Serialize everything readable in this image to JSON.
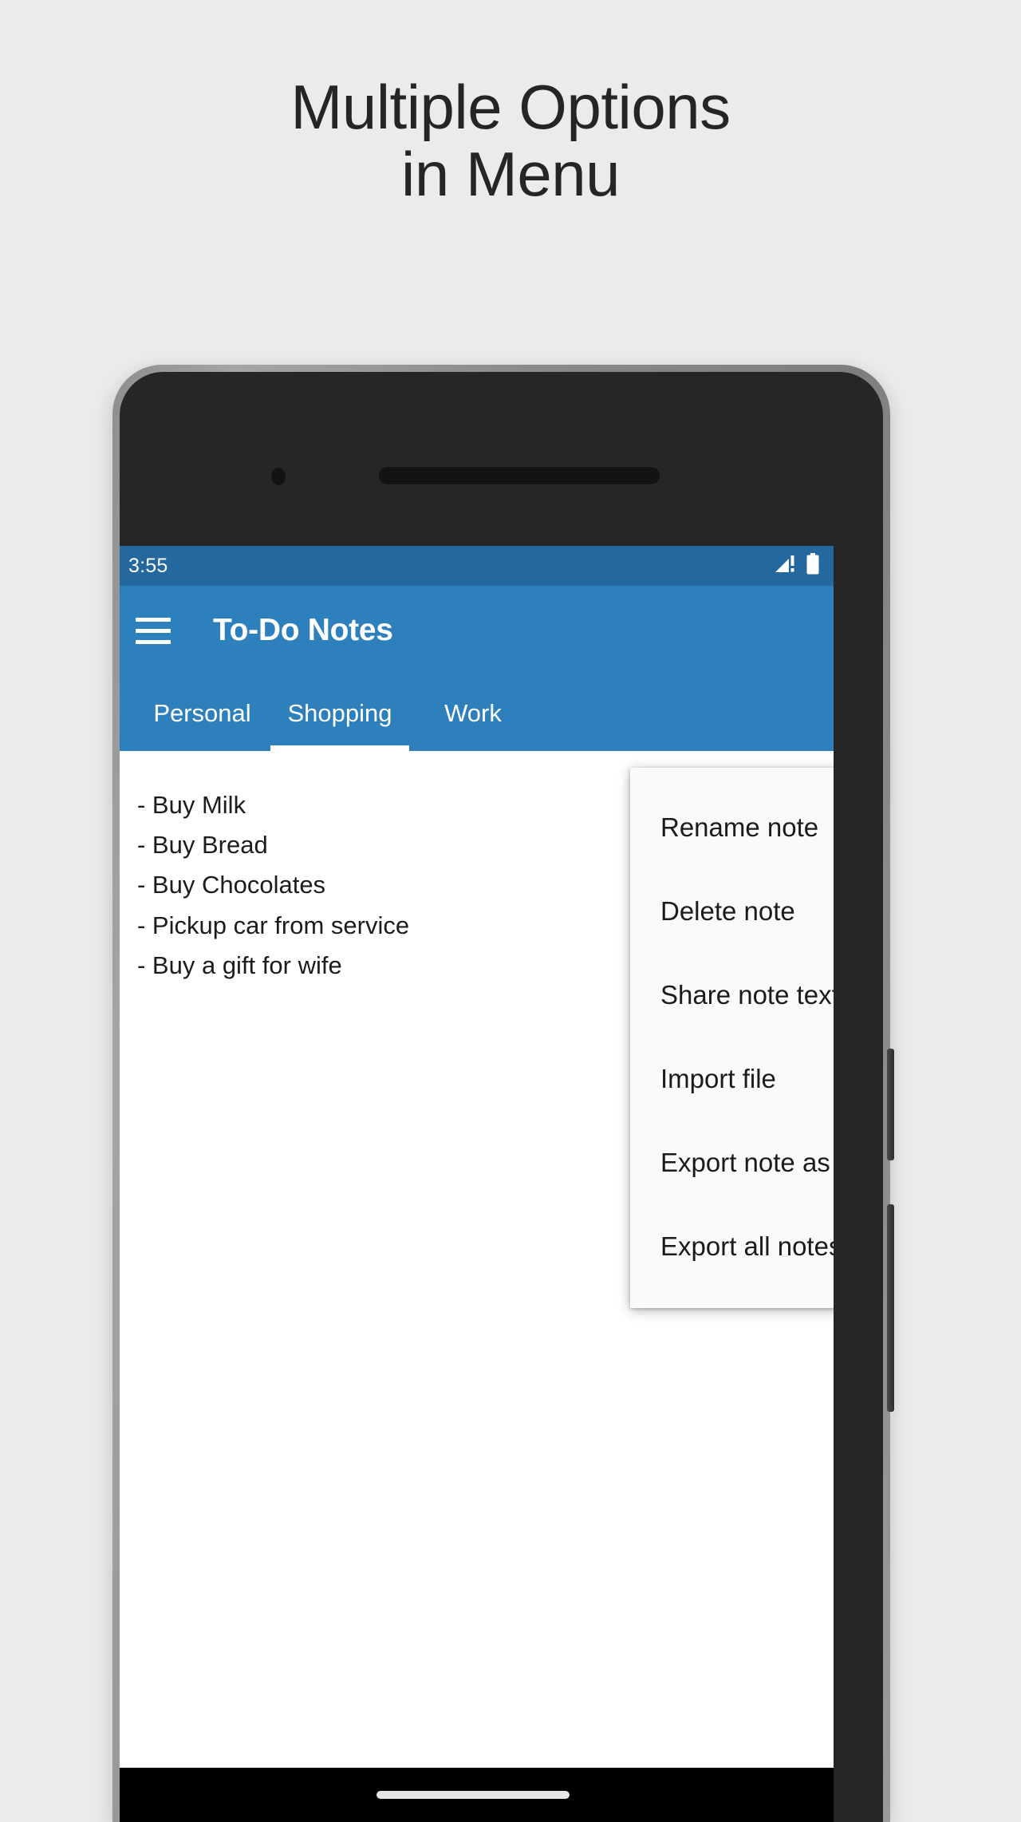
{
  "headline": {
    "line1": "Multiple Options",
    "line2": "in Menu"
  },
  "colors": {
    "page_background": "#ebebeb",
    "status_bar": "#24689e",
    "app_bar": "#2d80bb",
    "menu_background": "#fafafa",
    "text_primary": "#1b1b1b",
    "on_primary": "#ffffff"
  },
  "phone": {
    "status_bar": {
      "time": "3:55",
      "icons": [
        "signal-icon",
        "battery-icon"
      ]
    },
    "app_bar": {
      "menu_icon": "hamburger-icon",
      "title": "To-Do Notes"
    },
    "tabs": [
      {
        "label": "Personal",
        "active": false
      },
      {
        "label": "Shopping",
        "active": true
      },
      {
        "label": "Work",
        "active": false
      }
    ],
    "note": {
      "lines": [
        "- Buy Milk",
        "- Buy Bread",
        "- Buy Chocolates",
        "- Pickup car from service",
        "- Buy a gift for wife"
      ]
    },
    "popup_menu": {
      "items": [
        "Rename note",
        "Delete note",
        "Share note text",
        "Import file",
        "Export note as file",
        "Export all notes as file"
      ]
    },
    "nav_bar": {
      "gesture_pill": "home-gesture-pill"
    }
  }
}
